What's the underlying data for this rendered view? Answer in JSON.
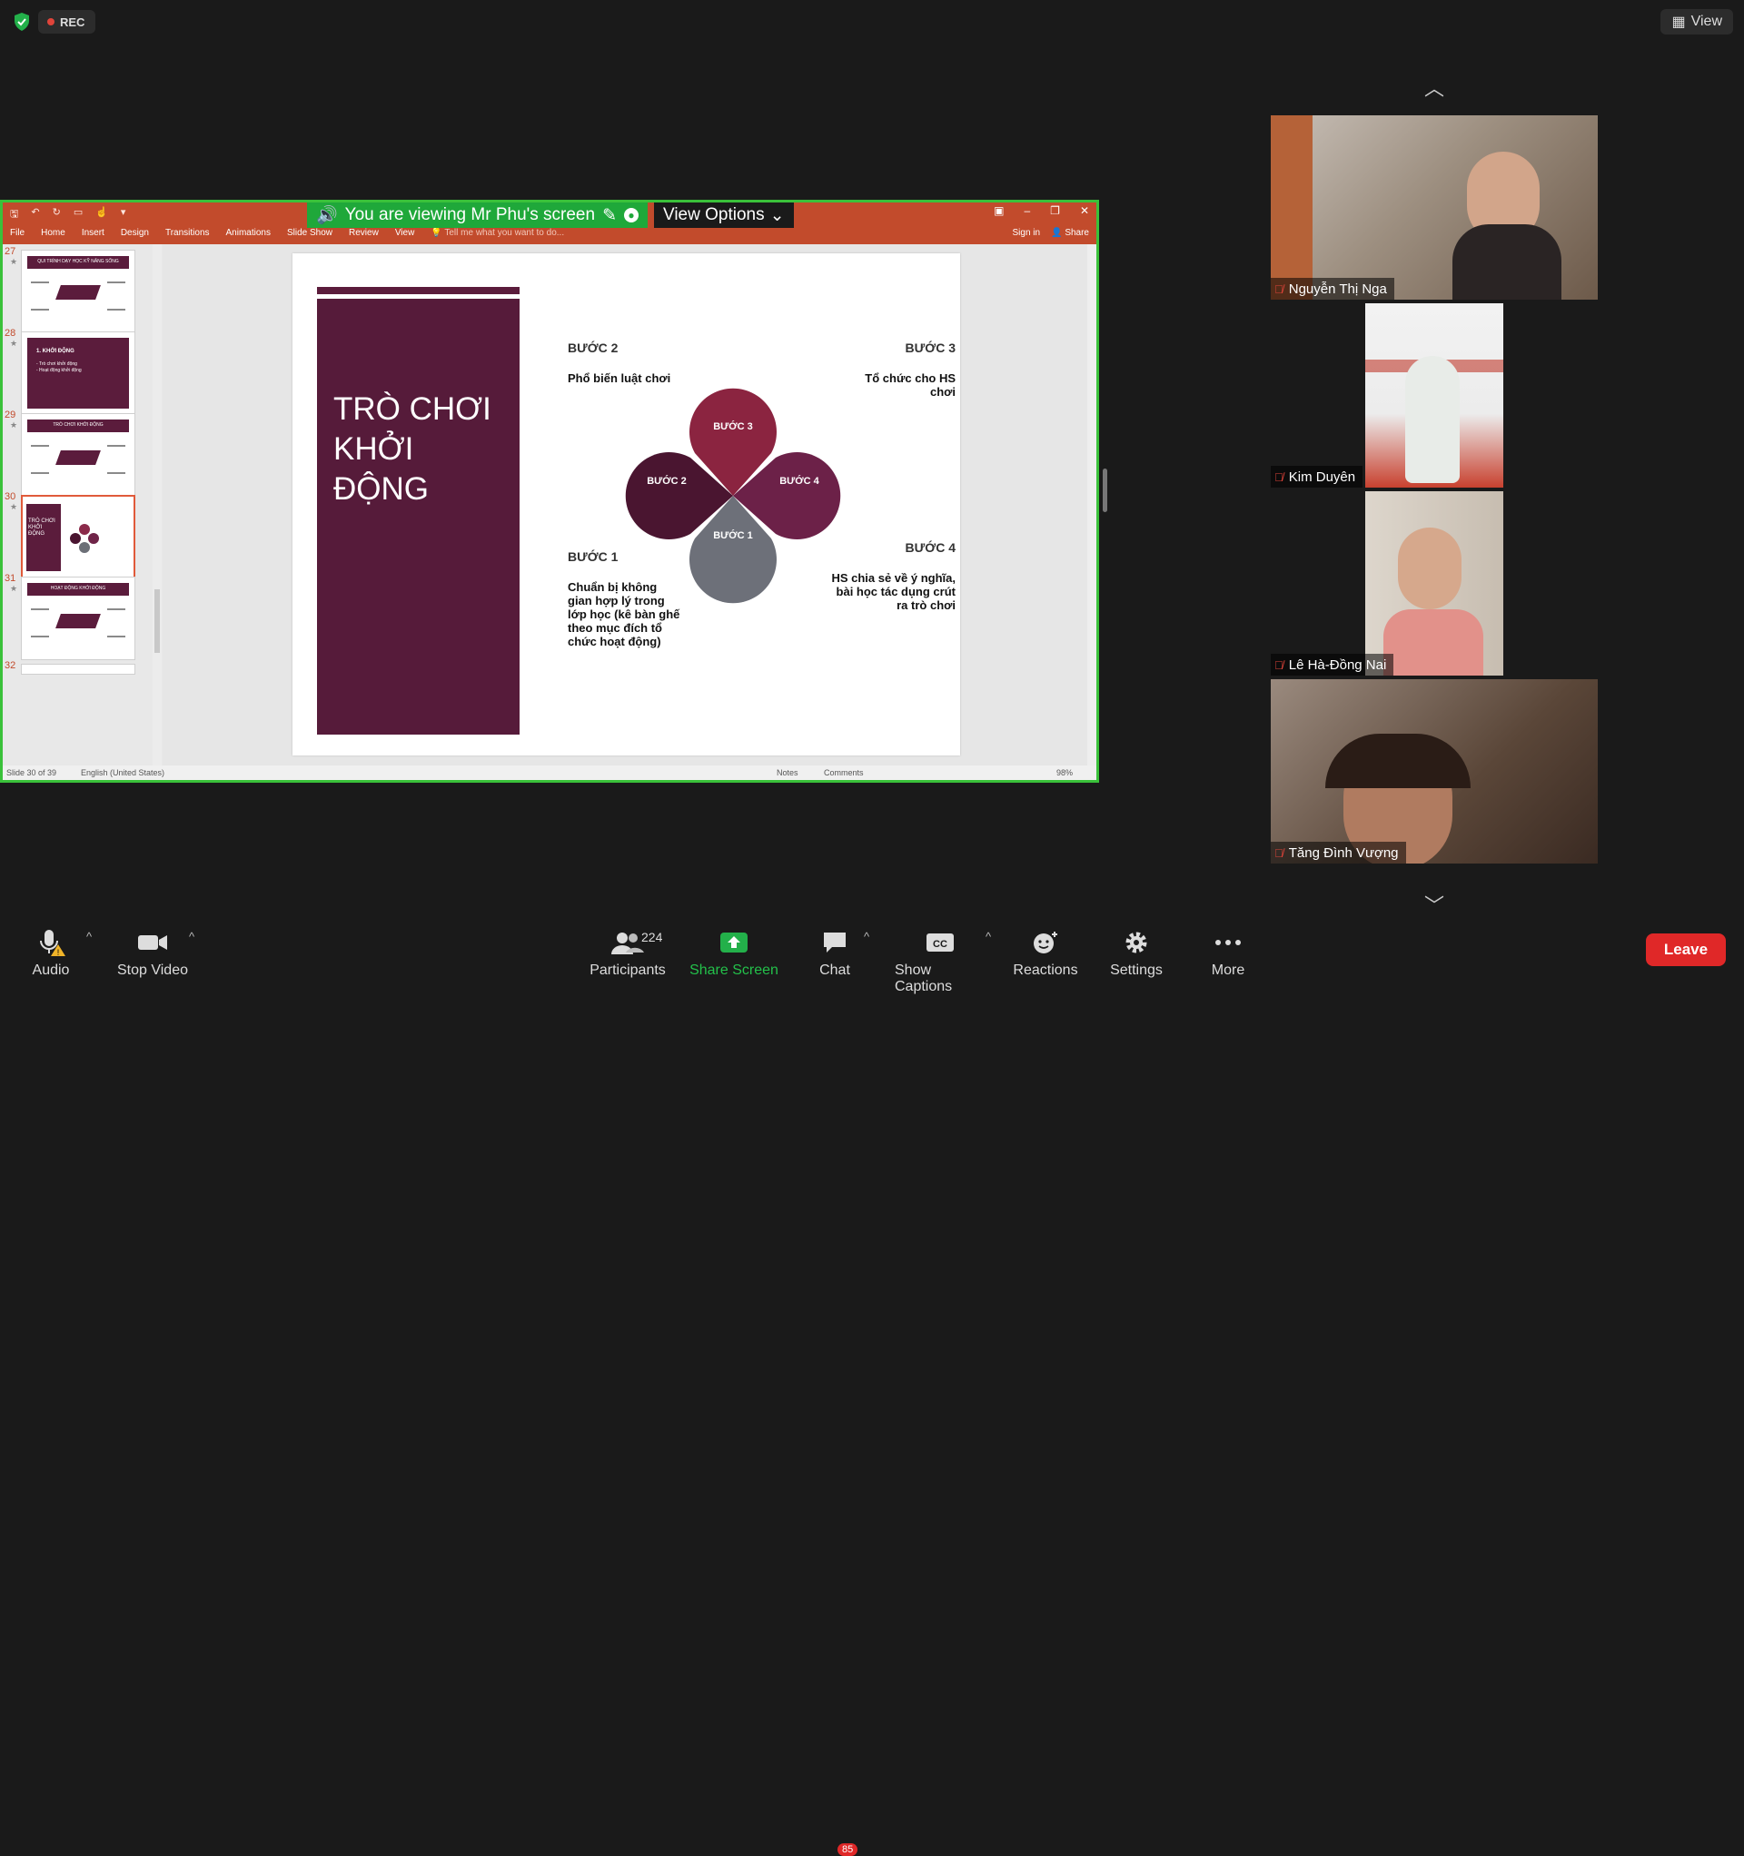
{
  "top": {
    "rec_label": "REC",
    "view_label": "View"
  },
  "share": {
    "banner": "You are viewing Mr Phu's screen",
    "view_options": "View Options",
    "ribbon_menu": [
      "File",
      "Home",
      "Insert",
      "Design",
      "Transitions",
      "Animations",
      "Slide Show",
      "Review",
      "View"
    ],
    "tell_me": "Tell me what you want to do...",
    "sign_in": "Sign in",
    "share_label": "Share",
    "thumb_numbers": [
      "27",
      "28",
      "29",
      "30",
      "31",
      "32"
    ],
    "thumbnails": [
      {
        "title": "QUI TRÌNH DẠY HỌC KỸ NĂNG SỐNG"
      },
      {
        "title": "1. KHỞI ĐỘNG",
        "lines": [
          "- Trò chơi khởi động",
          "- Hoạt động khởi động"
        ]
      },
      {
        "title": "TRÒ CHƠI KHỞI ĐỘNG"
      },
      {
        "title": "TRÒ CHƠI KHỞI ĐỘNG"
      },
      {
        "title": "HOẠT ĐỘNG KHỞI ĐỘNG"
      }
    ],
    "slide": {
      "title": "TRÒ CHƠI\nKHỞI\nĐỘNG",
      "step2_label": "BƯỚC 2",
      "step2_desc": "Phổ biến luật chơi",
      "step3_label": "BƯỚC 3",
      "step3_desc": "Tổ chức cho HS chơi",
      "step1_label": "BƯỚC 1",
      "step1_desc": "Chuẩn bị không gian hợp lý trong lớp học (kê bàn ghế theo mục đích tổ chức hoạt động)",
      "step4_label": "BƯỚC 4",
      "step4_desc": "HS chia sẻ về ý nghĩa, bài học tác dụng crút ra trò chơi",
      "petal1": "BƯỚC 1",
      "petal2": "BƯỚC 2",
      "petal3": "BƯỚC 3",
      "petal4": "BƯỚC 4"
    },
    "status": {
      "slide_count": "Slide 30 of 39",
      "language": "English (United States)",
      "notes": "Notes",
      "comments": "Comments",
      "zoom": "98%"
    }
  },
  "participants": [
    {
      "name": "Nguyễn Thị Nga"
    },
    {
      "name": "Kim Duyên"
    },
    {
      "name": "Lê Hà-Đồng Nai"
    },
    {
      "name": "Tăng Đình Vượng"
    }
  ],
  "toolbar": {
    "audio": "Audio",
    "stop_video": "Stop Video",
    "participants": "Participants",
    "participants_count": "224",
    "share_screen": "Share Screen",
    "chat": "Chat",
    "chat_badge": "85",
    "captions": "Show Captions",
    "reactions": "Reactions",
    "settings": "Settings",
    "more": "More",
    "leave": "Leave"
  },
  "colors": {
    "share_green": "#3ac13a",
    "slide_maroon": "#561b3a",
    "leave_red": "#e02828",
    "ribbon": "#c24b2c"
  }
}
